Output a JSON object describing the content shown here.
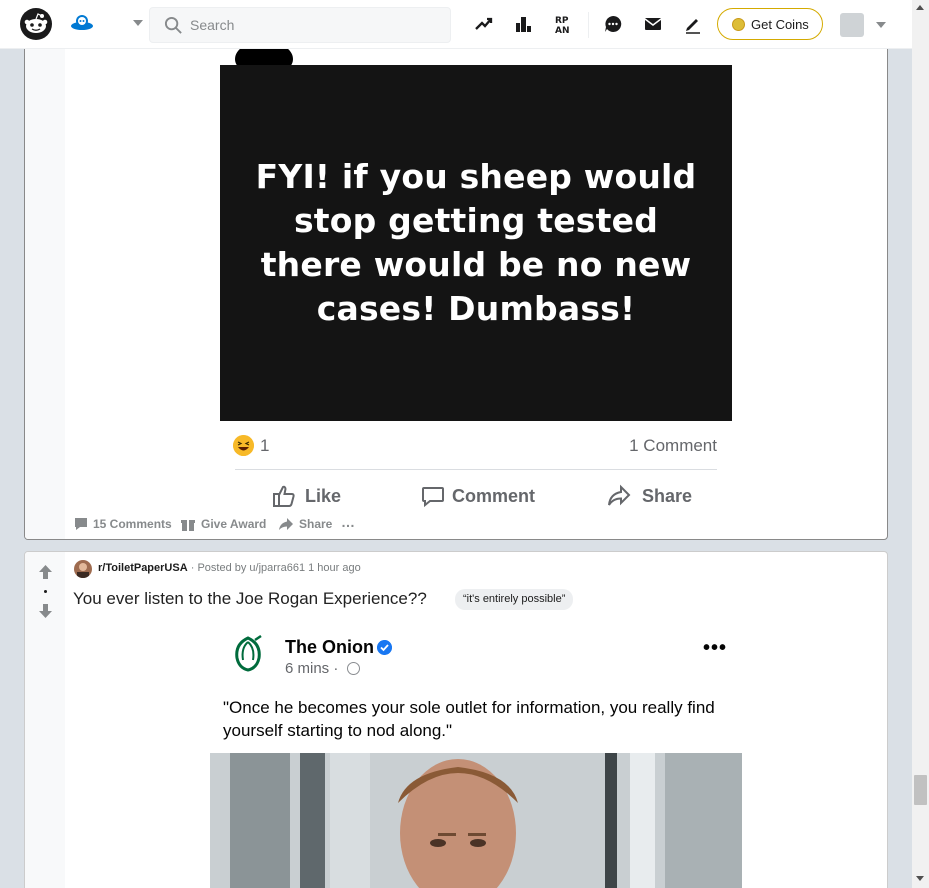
{
  "header": {
    "search_placeholder": "Search",
    "get_coins_label": "Get Coins",
    "icons": [
      "reddit-logo-icon",
      "home-snoo-icon",
      "popular-trending-icon",
      "leaderboard-icon",
      "rpan-icon",
      "chat-icon",
      "mail-icon",
      "create-post-icon",
      "coin-icon"
    ]
  },
  "post1": {
    "embedded_text_lines": [
      "FYI! if you sheep would",
      "stop getting tested",
      "there would be no new",
      "cases! Dumbass!"
    ],
    "reaction_count": "1",
    "comment_count": "1 Comment",
    "fb_actions": {
      "like": "Like",
      "comment": "Comment",
      "share": "Share"
    },
    "bar": {
      "comments": "15 Comments",
      "award": "Give Award",
      "share": "Share",
      "more": "…"
    }
  },
  "post2": {
    "subreddit": "r/ToiletPaperUSA",
    "posted_by": "· Posted by u/jparra661 1 hour ago",
    "title": "You ever listen to the Joe Rogan Experience??",
    "flair": "“it's entirely possible”",
    "vote_dot": "•",
    "embed": {
      "page_name": "The Onion",
      "time": "6 mins ·",
      "quote": "\"Once he becomes your sole outlet for information, you really find yourself starting to nod along.\"",
      "more": "•••"
    }
  },
  "colors": {
    "brand_blue": "#0079d3",
    "coin_gold": "#d4aa00",
    "fb_gray": "#65676b",
    "background": "#dae0e6"
  }
}
